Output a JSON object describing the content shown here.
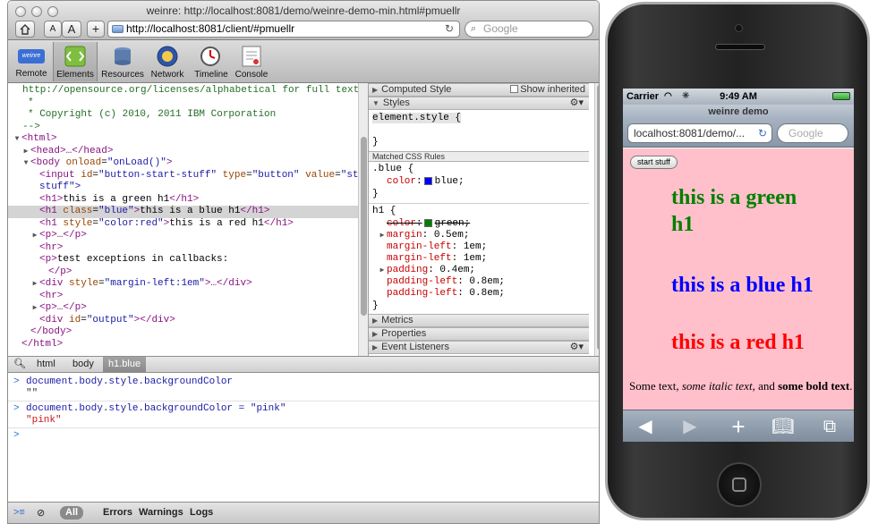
{
  "window": {
    "title": "weinre: http://localhost:8081/demo/weinre-demo-min.html#pmuellr",
    "url": "http://localhost:8081/client/#pmuellr",
    "search_placeholder": "Google",
    "text_smaller": "A",
    "text_larger": "A",
    "add_label": "+"
  },
  "inspector_tabs": [
    {
      "label": "Remote",
      "icon": "weinre-logo-icon"
    },
    {
      "label": "Elements",
      "icon": "elements-icon"
    },
    {
      "label": "Resources",
      "icon": "resources-icon"
    },
    {
      "label": "Network",
      "icon": "network-icon"
    },
    {
      "label": "Timeline",
      "icon": "timeline-icon"
    },
    {
      "label": "Console",
      "icon": "console-icon"
    }
  ],
  "weinre_badge": "weinre",
  "tree": {
    "l0": "http://opensource.org/licenses/alphabetical for full text.",
    "l1": "*",
    "l2": "* Copyright (c) 2010, 2011 IBM Corporation",
    "l3": "-->",
    "html_open": "<html>",
    "head": "<head>…</head>",
    "body_tag": "<body",
    "body_attr": "onload",
    "body_val": "\"onLoad()\"",
    "input_tag": "<input",
    "input_id_attr": "id",
    "input_id_val": "\"button-start-stuff\"",
    "input_type_attr": "type",
    "input_type_val": "\"button\"",
    "input_value_attr": "value",
    "input_value_val": "\"start",
    "input_value_val2": "stuff\">",
    "h1_green": "this is a green h1",
    "h1_blue_class_attr": "class",
    "h1_blue_class_val": "\"blue\"",
    "h1_blue": "this is a blue h1",
    "h1_red_style_attr": "style",
    "h1_red_style_val": "\"color:red\"",
    "h1_red": "this is a red h1",
    "p1": "<p>…</p>",
    "hr1": "<hr>",
    "p2_text": "test exceptions in callbacks:",
    "p2_close": "</p>",
    "div_attr": "style",
    "div_val": "\"margin-left:1em\"",
    "div_rest": ">…</div>",
    "hr2": "<hr>",
    "p3": "<p>…</p>",
    "div2_attr": "id",
    "div2_val": "\"output\"",
    "div2_rest": "></div>",
    "body_close": "</body>",
    "html_close": "</html>"
  },
  "sidebar": {
    "computed_style": "Computed Style",
    "show_inherited": "Show inherited",
    "styles": "Styles",
    "element_style": "element.style {",
    "close_brace": "}",
    "matched_rules": "Matched CSS Rules",
    "blue_selector": ".blue {",
    "blue_prop": "color",
    "blue_val": "blue;",
    "h1_selector": "h1 {",
    "h1_props": [
      {
        "name": "color",
        "value": "green;",
        "struck": true
      },
      {
        "name": "margin",
        "value": "0.5em;"
      },
      {
        "name": "margin-left",
        "value": "1em;"
      },
      {
        "name": "margin-left",
        "value": "1em;"
      },
      {
        "name": "padding",
        "value": "0.4em;"
      },
      {
        "name": "padding-left",
        "value": "0.8em;"
      },
      {
        "name": "padding-left",
        "value": "0.8em;"
      }
    ],
    "metrics": "Metrics",
    "properties": "Properties",
    "event_listeners": "Event Listeners",
    "colors": {
      "blue": "#0000ff",
      "green": "#008000"
    }
  },
  "breadcrumbs": [
    "html",
    "body",
    "h1.blue"
  ],
  "console": {
    "cmd1": "document.body.style.backgroundColor",
    "res1": "\"\"",
    "cmd2": "document.body.style.backgroundColor = \"pink\"",
    "res2": "\"pink\""
  },
  "statusbar": {
    "all": "All",
    "errors": "Errors",
    "warnings": "Warnings",
    "logs": "Logs"
  },
  "iphone": {
    "carrier": "Carrier",
    "time": "9:49 AM",
    "page_title": "weinre demo",
    "url": "localhost:8081/demo/...",
    "search": "Google",
    "start_button": "start stuff",
    "h1_green": "this is a green h1",
    "h1_blue": "this is a blue h1",
    "h1_red": "this is a red h1",
    "para_a": "Some text, ",
    "para_italic": "some italic text",
    "para_b": ", and ",
    "para_bold": "some bold text",
    "para_end": "."
  }
}
